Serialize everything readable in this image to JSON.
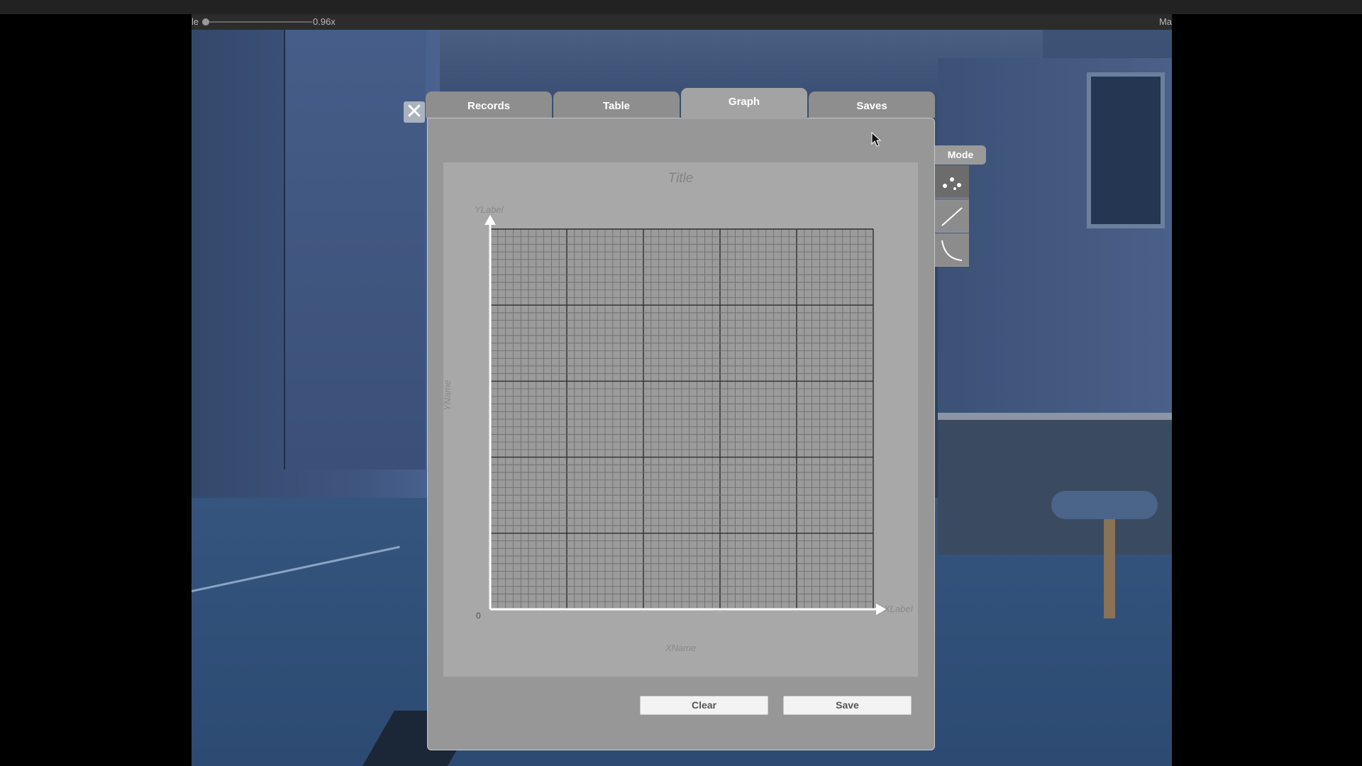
{
  "statusbar": {
    "left_label": "le",
    "speed": "0.96x",
    "right_label": "Ma"
  },
  "panel": {
    "close_icon": "close-icon",
    "tabs": [
      {
        "label": "Records",
        "active": false
      },
      {
        "label": "Table",
        "active": false
      },
      {
        "label": "Graph",
        "active": true
      },
      {
        "label": "Saves",
        "active": false
      }
    ],
    "graph": {
      "title": "Title",
      "ylabel": "YLabel",
      "xlabel": "XLabel",
      "xname": "XName",
      "yname": "YName",
      "origin": "0"
    },
    "buttons": {
      "clear": "Clear",
      "save": "Save"
    }
  },
  "mode": {
    "label": "Mode",
    "options": [
      {
        "icon": "scatter-points-icon",
        "active": true
      },
      {
        "icon": "straight-line-icon",
        "active": false
      },
      {
        "icon": "curve-line-icon",
        "active": false
      }
    ]
  },
  "colors": {
    "panel": "#979797",
    "graph_bg": "#a8a8a8",
    "grid_major": "#2e2e2e",
    "grid_minor": "#6a6a6a",
    "axis": "#ffffff"
  }
}
